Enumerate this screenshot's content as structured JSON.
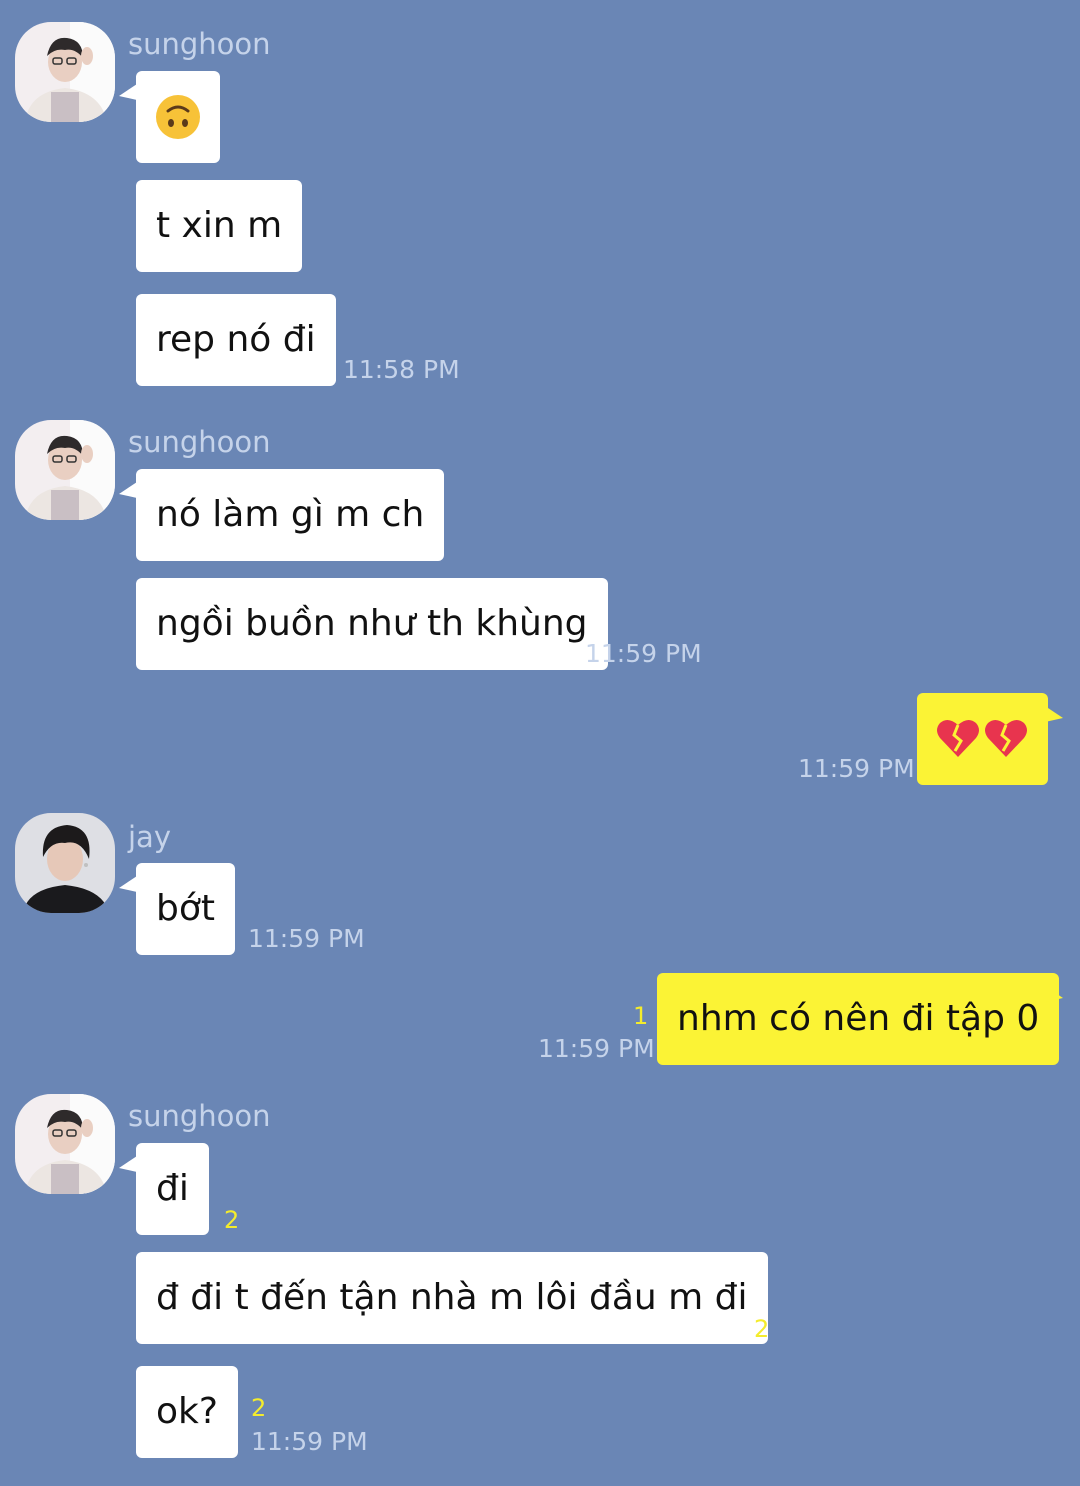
{
  "messages": [
    {
      "sender": "sunghoon",
      "text": "🙃"
    },
    {
      "text": "t xin m"
    },
    {
      "text": "rep nó đi",
      "time": "11:58 PM"
    },
    {
      "sender": "sunghoon",
      "text": "nó làm gì m ch"
    },
    {
      "text": "ngồi buồn như th khùng",
      "time": "11:59 PM"
    },
    {
      "text": "💔💔",
      "time": "11:59 PM",
      "outgoing": true
    },
    {
      "sender": "jay",
      "text": "bớt",
      "time": "11:59 PM"
    },
    {
      "text": "nhm có nên đi tập 0",
      "time": "11:59 PM",
      "outgoing": true,
      "unread": "1"
    },
    {
      "sender": "sunghoon",
      "text": "đi",
      "unread": "2"
    },
    {
      "text": "đ đi t đến tận nhà m lôi đầu m đi",
      "unread": "2"
    },
    {
      "text": "ok?",
      "time": "11:59 PM",
      "unread": "2"
    }
  ],
  "colors": {
    "background": "#6a86b5",
    "incoming_bubble": "#ffffff",
    "outgoing_bubble": "#fbf335",
    "meta_text": "#c5d3ea",
    "unread_count": "#f4ec2c"
  }
}
